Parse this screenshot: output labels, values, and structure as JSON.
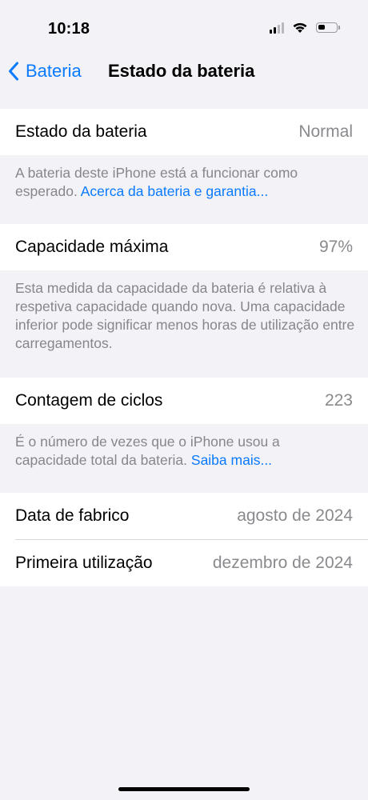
{
  "status_bar": {
    "time": "10:18",
    "battery_level_percent": 40
  },
  "nav": {
    "back_label": "Bateria",
    "title": "Estado da bateria"
  },
  "battery_state": {
    "label": "Estado da bateria",
    "value": "Normal",
    "footer_text": "A bateria deste iPhone está a funcionar como esperado. ",
    "footer_link": "Acerca da bateria e garantia..."
  },
  "max_capacity": {
    "label": "Capacidade máxima",
    "value": "97%",
    "footer_text": "Esta medida da capacidade da bateria é relativa à respetiva capacidade quando nova. Uma capacidade inferior pode significar menos horas de utilização entre carregamentos."
  },
  "cycle_count": {
    "label": "Contagem de ciclos",
    "value": "223",
    "footer_text": "É o número de vezes que o iPhone usou a capacidade total da bateria. ",
    "footer_link": "Saiba mais..."
  },
  "dates": {
    "manufacture_label": "Data de fabrico",
    "manufacture_value": "agosto de 2024",
    "first_use_label": "Primeira utilização",
    "first_use_value": "dezembro de 2024"
  },
  "colors": {
    "accent": "#0a7aff",
    "background": "#f2f2f7",
    "secondary_text": "#8a8a8e"
  }
}
